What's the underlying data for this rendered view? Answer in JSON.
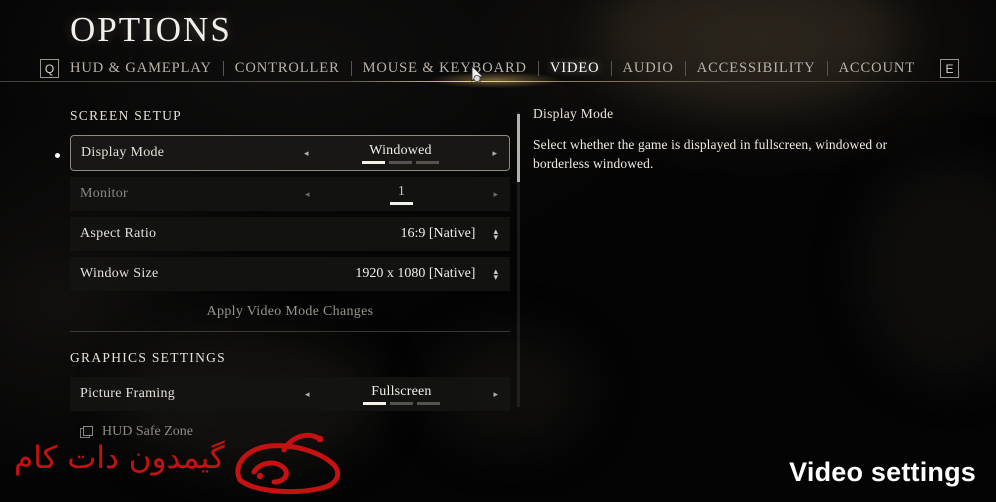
{
  "header": {
    "title": "OPTIONS",
    "prev_key": "Q",
    "next_key": "E",
    "tabs": [
      {
        "label": "HUD & GAMEPLAY",
        "active": false
      },
      {
        "label": "CONTROLLER",
        "active": false
      },
      {
        "label": "MOUSE & KEYBOARD",
        "active": false
      },
      {
        "label": "VIDEO",
        "active": true
      },
      {
        "label": "AUDIO",
        "active": false
      },
      {
        "label": "ACCESSIBILITY",
        "active": false
      },
      {
        "label": "ACCOUNT",
        "active": false
      }
    ]
  },
  "sections": {
    "screen_setup": {
      "label": "SCREEN SETUP",
      "rows": {
        "display_mode": {
          "label": "Display Mode",
          "value": "Windowed",
          "segments_total": 3,
          "segment_active": 1,
          "arrow_left": "◂",
          "arrow_right": "▸"
        },
        "monitor": {
          "label": "Monitor",
          "value": "1",
          "segments_total": 1,
          "segment_active": 1,
          "arrow_left": "◂",
          "arrow_right": "▸"
        },
        "aspect_ratio": {
          "label": "Aspect Ratio",
          "value": "16:9 [Native]",
          "stepper_up": "▴",
          "stepper_down": "▾"
        },
        "window_size": {
          "label": "Window Size",
          "value": "1920 x 1080 [Native]",
          "stepper_up": "▴",
          "stepper_down": "▾"
        },
        "apply": {
          "label": "Apply Video Mode Changes"
        }
      }
    },
    "graphics_settings": {
      "label": "GRAPHICS SETTINGS",
      "rows": {
        "picture_framing": {
          "label": "Picture Framing",
          "value": "Fullscreen",
          "segments_total": 3,
          "segment_active": 1,
          "arrow_left": "◂",
          "arrow_right": "▸"
        },
        "hud_safe_zone": {
          "label": "HUD Safe Zone"
        }
      }
    }
  },
  "description": {
    "title": "Display Mode",
    "body": "Select whether the game is displayed in fullscreen, windowed or borderless windowed."
  },
  "caption": {
    "text": "Video settings"
  },
  "watermark": {
    "text": "گیمدون دات کام",
    "color": "#c41212"
  },
  "colors": {
    "accent_gold": "#ffe2a0",
    "text_primary": "#f1eee6",
    "text_dim": "#8e8b84",
    "segment_on": "#f4f1e9",
    "segment_off": "#56534d"
  }
}
